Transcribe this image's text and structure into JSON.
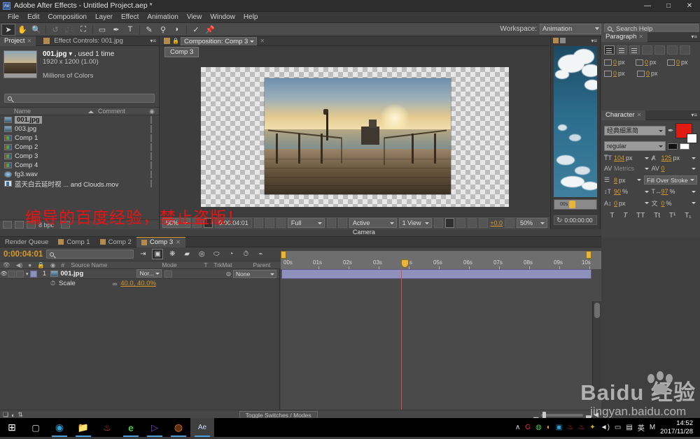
{
  "window": {
    "title": "Adobe After Effects - Untitled Project.aep *",
    "app_badge": "Ae",
    "minimize": "—",
    "maximize": "□",
    "close": "✕"
  },
  "menu": {
    "items": [
      "File",
      "Edit",
      "Composition",
      "Layer",
      "Effect",
      "Animation",
      "View",
      "Window",
      "Help"
    ]
  },
  "toolbar": {
    "tools": [
      {
        "name": "selection-tool",
        "glyph": "➤"
      },
      {
        "name": "hand-tool",
        "glyph": "✋"
      },
      {
        "name": "zoom-tool",
        "glyph": "🔍"
      },
      {
        "name": "rotation-tool",
        "glyph": "↺"
      },
      {
        "name": "camera-tool",
        "glyph": "🎥"
      },
      {
        "name": "anchor-point-tool",
        "glyph": "⛶"
      },
      {
        "name": "shape-tool",
        "glyph": "▭"
      },
      {
        "name": "pen-tool",
        "glyph": "✒"
      },
      {
        "name": "type-tool",
        "glyph": "T"
      },
      {
        "name": "brush-tool",
        "glyph": "✎"
      },
      {
        "name": "clone-stamp-tool",
        "glyph": "⚲"
      },
      {
        "name": "eraser-tool",
        "glyph": "◗"
      },
      {
        "name": "roto-brush-tool",
        "glyph": "✓"
      },
      {
        "name": "puppet-pin-tool",
        "glyph": "📌"
      }
    ],
    "workspace_label": "Workspace:",
    "workspace_value": "Animation",
    "search_help_placeholder": "Search Help"
  },
  "project_panel": {
    "tabs": [
      {
        "label": "Project",
        "active": true,
        "closable": true
      },
      {
        "label": "Effect Controls: 001.jpg",
        "active": false,
        "closable": false
      }
    ],
    "selected_item_title": "001.jpg",
    "selected_item_usage": ", used 1 time",
    "selected_item_dims": "1920 x 1200 (1.00)",
    "selected_item_color": "Millions of Colors",
    "search_placeholder": "",
    "columns": {
      "name": "Name",
      "comment": "Comment"
    },
    "items": [
      {
        "label": "001.jpg",
        "type": "image",
        "selected": true
      },
      {
        "label": "003.jpg",
        "type": "image",
        "selected": false
      },
      {
        "label": "Comp 1",
        "type": "comp",
        "selected": false
      },
      {
        "label": "Comp 2",
        "type": "comp",
        "selected": false
      },
      {
        "label": "Comp 3",
        "type": "comp",
        "selected": false
      },
      {
        "label": "Comp 4",
        "type": "comp",
        "selected": false
      },
      {
        "label": "fg3.wav",
        "type": "audio",
        "selected": false
      },
      {
        "label": "蓝天白云延时视 ... and Clouds.mov",
        "type": "movie",
        "selected": false
      }
    ],
    "footer_bpc": "8 bpc"
  },
  "composition_panel": {
    "tab_label": "Composition: Comp 3",
    "comp_chip": "Comp 3",
    "toolbar": {
      "magnification": "50%",
      "current_time": "0:00:04:01",
      "resolution": "Full",
      "camera": "Active Camera",
      "views": "1 View",
      "exposure": "+0.0"
    },
    "zoom_right": "50%"
  },
  "footage_preview": {
    "timecode": "0:00:00:00",
    "mini_label": "00s"
  },
  "paragraph_panel": {
    "tab_label": "Paragraph",
    "fields": [
      {
        "name": "indent-left",
        "value": "0",
        "unit": "px"
      },
      {
        "name": "indent-right",
        "value": "0",
        "unit": "px"
      },
      {
        "name": "indent-first-line",
        "value": "0",
        "unit": "px"
      },
      {
        "name": "space-before",
        "value": "0",
        "unit": "px"
      },
      {
        "name": "space-after",
        "value": "0",
        "unit": "px"
      }
    ]
  },
  "character_panel": {
    "tab_label": "Character",
    "font_family": "经典细黑简",
    "font_style": "regular",
    "font_size": "104",
    "font_size_unit": "px",
    "leading": "125",
    "leading_unit": "px",
    "kerning": "Metrics",
    "tracking": "0",
    "stroke_width": "8",
    "stroke_width_unit": "px",
    "fill_stroke_order": "Fill Over Stroke",
    "vertical_scale": "90",
    "vertical_scale_unit": "%",
    "horizontal_scale": "97",
    "horizontal_scale_unit": "%",
    "baseline_shift": "0",
    "baseline_shift_unit": "px",
    "tsume": "0",
    "tsume_unit": "%",
    "fill_color": "#e11b11",
    "stroke_color": "#ffffff",
    "style_buttons": [
      "T",
      "T",
      "TT",
      "Tt",
      "T¹",
      "T₁"
    ]
  },
  "timeline_panel": {
    "tabs": [
      {
        "label": "Render Queue",
        "active": false,
        "has_square": false
      },
      {
        "label": "Comp 1",
        "active": false,
        "has_square": true
      },
      {
        "label": "Comp 2",
        "active": false,
        "has_square": true
      },
      {
        "label": "Comp 3",
        "active": true,
        "has_square": true
      }
    ],
    "current_time": "0:00:04:01",
    "search_placeholder": "",
    "columns": [
      "Source Name",
      "Mode",
      "T",
      "TrkMat",
      "Parent"
    ],
    "switch_headers": "# ",
    "layers": [
      {
        "index": "1",
        "name": "001.jpg",
        "mode": "Nor...",
        "parent": "None",
        "properties": [
          {
            "name": "Scale",
            "value": "40.0, 40.0%"
          }
        ]
      }
    ],
    "ruler_ticks": [
      "00s",
      "01s",
      "02s",
      "03s",
      "04s",
      "05s",
      "06s",
      "07s",
      "08s",
      "09s",
      "10s"
    ],
    "toggle_switches_label": "Toggle Switches / Modes"
  },
  "watermarks": {
    "red_note": "编导的百度经验，禁止盗版！",
    "baidu_line1": "Baidu 经验",
    "baidu_brand": "Bai",
    "baidu_brand2": "du",
    "baidu_cn": "经验",
    "baidu_url": "jingyan.baidu.com"
  },
  "taskbar": {
    "items": [
      {
        "name": "start-button",
        "glyph": "⊞"
      },
      {
        "name": "task-view-button",
        "glyph": "▢"
      },
      {
        "name": "taskbar-media-player",
        "glyph": "◉"
      },
      {
        "name": "taskbar-file-explorer",
        "glyph": "📁"
      },
      {
        "name": "taskbar-app-red",
        "glyph": "♨"
      },
      {
        "name": "taskbar-browser-360",
        "glyph": "e"
      },
      {
        "name": "taskbar-app-play",
        "glyph": "▷"
      },
      {
        "name": "taskbar-firefox",
        "glyph": "◍"
      },
      {
        "name": "taskbar-after-effects",
        "glyph": "Ae"
      }
    ],
    "tray": [
      "∧",
      "G",
      "◍",
      "◐",
      "▣",
      "♨",
      "♨",
      "✦",
      "◄)",
      "▭",
      "▤",
      "英",
      "M"
    ],
    "time": "14:52",
    "date": "2017/11/28"
  },
  "colors": {
    "accent_orange": "#d79a2b",
    "panel_bg": "#434343",
    "layer_bar": "#8f90bb",
    "playhead": "#e04a4a",
    "red_text": "#ee1111"
  }
}
